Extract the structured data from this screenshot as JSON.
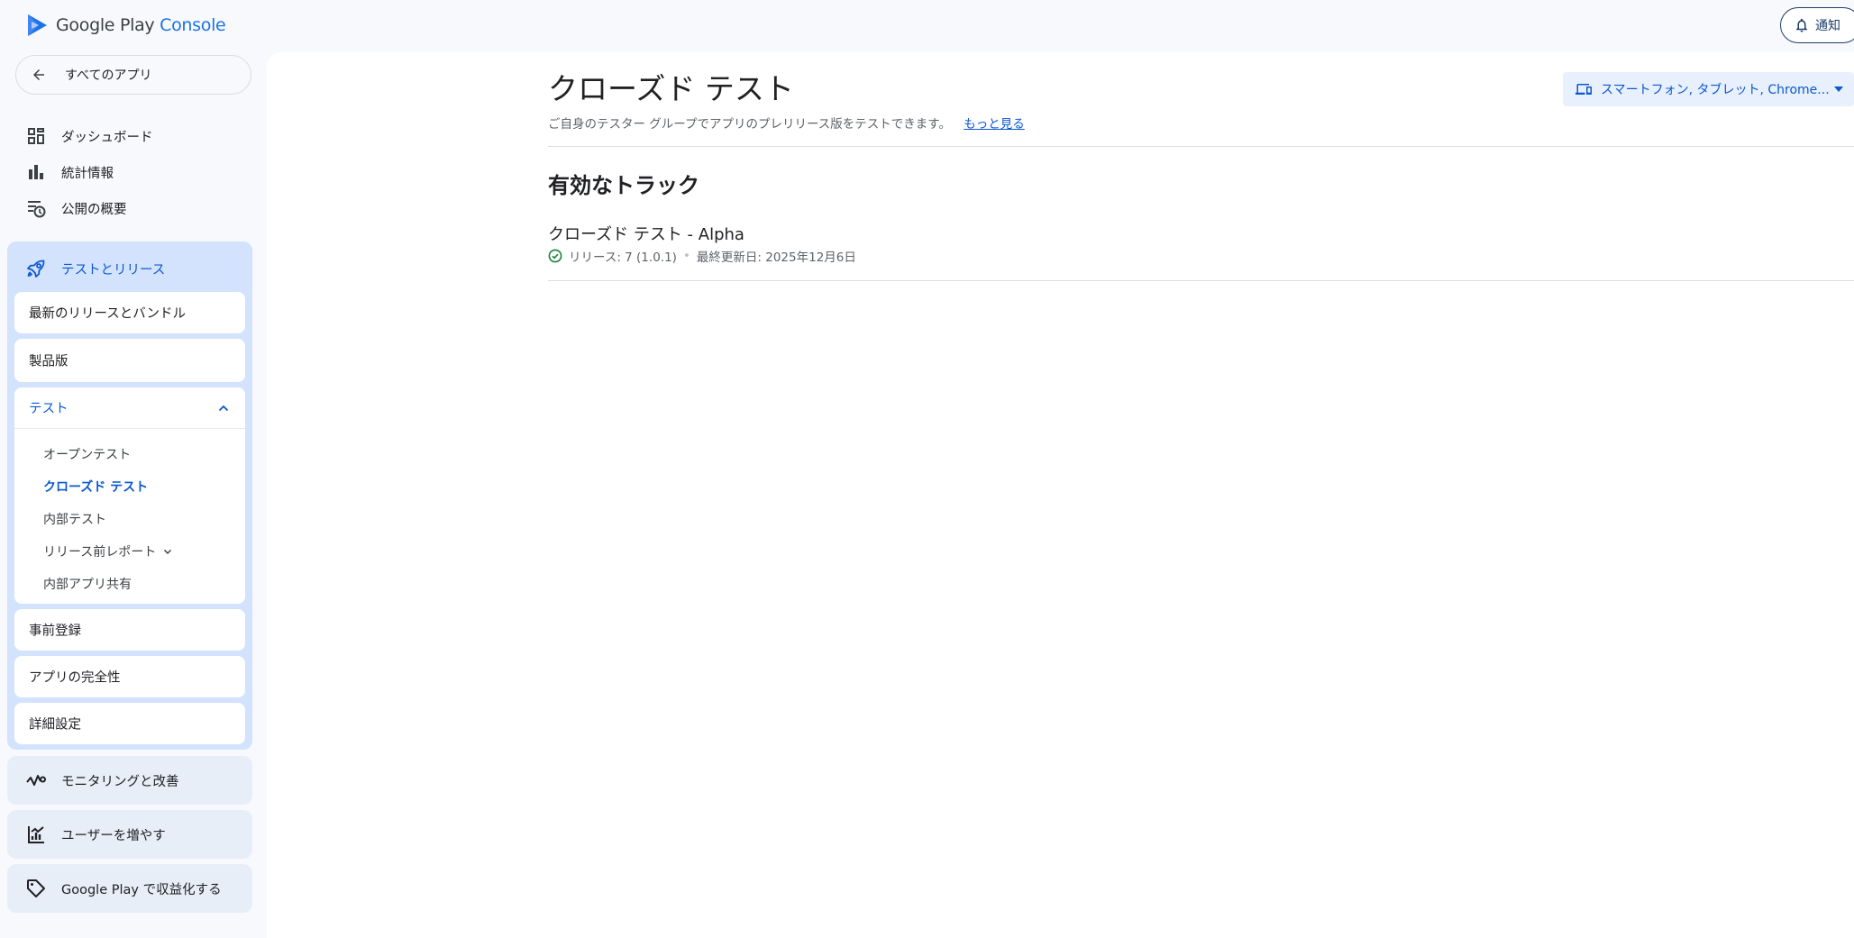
{
  "app": {
    "logo_google_play": "Google Play",
    "logo_console": "Console"
  },
  "header": {
    "notify_label": "通知"
  },
  "sidebar": {
    "back_label": "すべてのアプリ",
    "top_items": [
      {
        "label": "ダッシュボード",
        "icon": "dashboard-icon"
      },
      {
        "label": "統計情報",
        "icon": "bar-chart-icon"
      },
      {
        "label": "公開の概要",
        "icon": "publishing-overview-icon"
      }
    ],
    "test_release": {
      "label": "テストとリリース",
      "icon": "rocket-icon",
      "items": [
        {
          "label": "最新のリリースとバンドル"
        },
        {
          "label": "製品版"
        }
      ],
      "test": {
        "label": "テスト",
        "expanded": true,
        "sub_items": [
          {
            "label": "オープンテスト"
          },
          {
            "label": "クローズド テスト",
            "active": true
          },
          {
            "label": "内部テスト"
          },
          {
            "label": "リリース前レポート",
            "has_children": true
          },
          {
            "label": "内部アプリ共有"
          }
        ]
      },
      "more_items": [
        {
          "label": "事前登録"
        },
        {
          "label": "アプリの完全性"
        },
        {
          "label": "詳細設定"
        }
      ]
    },
    "other_groups": [
      {
        "label": "モニタリングと改善",
        "icon": "monitoring-icon"
      },
      {
        "label": "ユーザーを増やす",
        "icon": "grow-users-icon"
      },
      {
        "label": "Google Play で収益化する",
        "icon": "tag-icon"
      }
    ]
  },
  "main": {
    "title": "クローズド テスト",
    "subtitle": "ご自身のテスター グループでアプリのプレリリース版をテストできます。",
    "learn_more": "もっと見る",
    "device_filter": "スマートフォン, タブレット, Chrome...",
    "section_title": "有効なトラック",
    "track": {
      "name": "クローズド テスト - Alpha",
      "release": "リリース: 7 (1.0.1)",
      "separator": "•",
      "updated": "最終更新日: 2025年12月6日"
    }
  },
  "colors": {
    "accent": "#0b57d0",
    "active_group_bg": "#d3e3fd",
    "success": "#188038"
  }
}
